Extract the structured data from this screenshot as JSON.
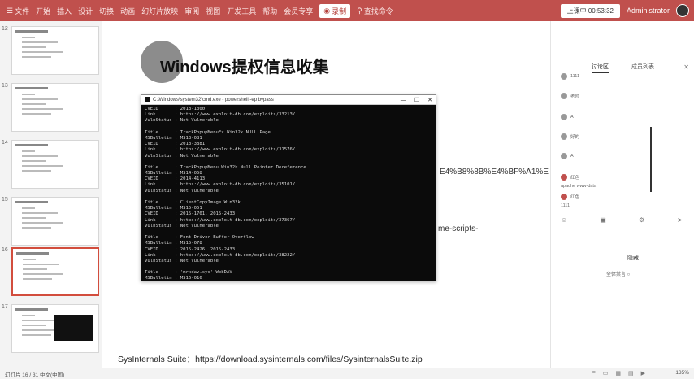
{
  "ribbon": {
    "tabs": [
      {
        "icon": "file-icon",
        "glyph": "☰",
        "label": "文件"
      },
      {
        "icon": "start-icon",
        "glyph": "",
        "label": "开始"
      },
      {
        "icon": "insert-icon",
        "glyph": "",
        "label": "插入"
      },
      {
        "icon": "design-icon",
        "glyph": "",
        "label": "设计"
      },
      {
        "icon": "transition-icon",
        "glyph": "",
        "label": "切换"
      },
      {
        "icon": "animation-icon",
        "glyph": "",
        "label": "动画"
      },
      {
        "icon": "slideshow-icon",
        "glyph": "",
        "label": "幻灯片放映"
      },
      {
        "icon": "review-icon",
        "glyph": "",
        "label": "审阅"
      },
      {
        "icon": "view-icon",
        "glyph": "",
        "label": "视图"
      },
      {
        "icon": "tools-icon",
        "glyph": "",
        "label": "开发工具"
      },
      {
        "icon": "help-icon",
        "glyph": "",
        "label": "帮助"
      },
      {
        "icon": "member-icon",
        "glyph": "",
        "label": "会员专享"
      },
      {
        "icon": "record-icon",
        "glyph": "◉",
        "label": "录制"
      },
      {
        "icon": "search-icon",
        "glyph": "⚲",
        "label": "查找命令"
      }
    ],
    "active_tab_index": 12,
    "stream_tip": "上课中 00:53:32",
    "user": "Administrator"
  },
  "thumbnails": [
    {
      "number": "12",
      "active": false
    },
    {
      "number": "13",
      "active": false
    },
    {
      "number": "14",
      "active": false
    },
    {
      "number": "15",
      "active": false
    },
    {
      "number": "16",
      "active": true
    },
    {
      "number": "17",
      "active": false
    }
  ],
  "slide": {
    "title": "Windows提权信息收集",
    "footer": "SysInternals Suite：https://download.sysinternals.com/files/SysinternalsSuite.zip",
    "partial_url_1": "E4%B8%8B%E4%BF%A1%E",
    "partial_url_2": "me-scripts-"
  },
  "cmd": {
    "title": "C:\\Windows\\system32\\cmd.exe - powershell -ep bypass",
    "lines": [
      "CVEID      : 2013-1300",
      "Link       : https://www.exploit-db.com/exploits/33213/",
      "VulnStatus : Not Vulnerable",
      "",
      "Title      : TrackPopupMenuEx Win32k NULL Page",
      "MSBulletin : MS13-081",
      "CVEID      : 2013-3881",
      "Link       : https://www.exploit-db.com/exploits/31576/",
      "VulnStatus : Not Vulnerable",
      "",
      "Title      : TrackPopupMenu Win32k Null Pointer Dereference",
      "MSBulletin : MS14-058",
      "CVEID      : 2014-4113",
      "Link       : https://www.exploit-db.com/exploits/35101/",
      "VulnStatus : Not Vulnerable",
      "",
      "Title      : ClientCopyImage Win32k",
      "MSBulletin : MS15-051",
      "CVEID      : 2015-1701, 2015-2433",
      "Link       : https://www.exploit-db.com/exploits/37367/",
      "VulnStatus : Not Vulnerable",
      "",
      "Title      : Font Driver Buffer Overflow",
      "MSBulletin : MS15-078",
      "CVEID      : 2015-2426, 2015-2433",
      "Link       : https://www.exploit-db.com/exploits/38222/",
      "VulnStatus : Not Vulnerable",
      "",
      "Title      : 'mrxdav.sys' WebDAV",
      "MSBulletin : MS16-016"
    ]
  },
  "right_panel": {
    "tabs": [
      "讨论区",
      "成员列表"
    ],
    "chats": [
      {
        "text": "1111"
      },
      {
        "text": "老师"
      },
      {
        "text": "A"
      },
      {
        "text": "好的"
      },
      {
        "text": "A"
      }
    ],
    "red_user_chats": [
      {
        "text": "红色"
      },
      {
        "text": "红色"
      }
    ],
    "plain_lines": [
      "apache www-data",
      "1111"
    ],
    "bottom_label_a": "隐藏",
    "bottom_label_b": "全体禁言 ○"
  },
  "status": {
    "left": "幻灯片 16 / 31    中文(中国)",
    "zoom": "135%"
  }
}
